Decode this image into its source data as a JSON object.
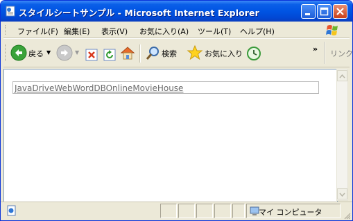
{
  "window": {
    "title": "スタイルシートサンプル - Microsoft Internet Explorer"
  },
  "menu": {
    "items": [
      "ファイル(F)",
      "編集(E)",
      "表示(V)",
      "お気に入り(A)",
      "ツール(T)",
      "ヘルプ(H)"
    ]
  },
  "toolbar": {
    "back_label": "戻る",
    "search_label": "検索",
    "favorites_label": "お気に入り",
    "links_label": "リンク",
    "overflow_label": "»"
  },
  "content": {
    "link_text": "JavaDriveWebWordDBOnlineMovieHouse"
  },
  "statusbar": {
    "zone_label": "マイ コンピュータ"
  },
  "colors": {
    "titlebar": "#0054e3",
    "chrome": "#ece9d8",
    "link": "#6b6b6b"
  }
}
